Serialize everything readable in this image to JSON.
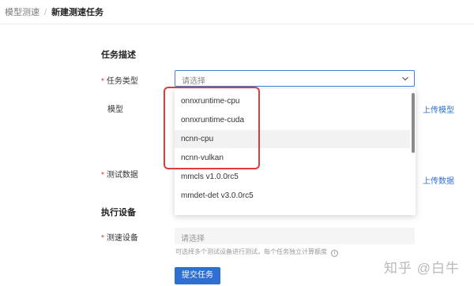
{
  "breadcrumb": {
    "parent": "模型测速",
    "separator": "/",
    "current": "新建测速任务"
  },
  "sections": {
    "task_desc": "任务描述",
    "exec_device": "执行设备"
  },
  "form": {
    "task_type": {
      "required_mark": "*",
      "label": "任务类型",
      "placeholder": "请选择"
    },
    "model": {
      "label": "模型",
      "upload_link": "上传模型"
    },
    "test_data": {
      "required_mark": "*",
      "label": "测试数据",
      "upload_link": "上传数据"
    },
    "device": {
      "required_mark": "*",
      "label": "测速设备",
      "placeholder": "请选择",
      "hint": "可选择多个测试设备进行测试，每个任务独立计算额度",
      "hint_icon": "i"
    },
    "submit_label": "提交任务"
  },
  "dropdown": {
    "options": [
      {
        "label": "onnxruntime-cpu"
      },
      {
        "label": "onnxruntime-cuda"
      },
      {
        "label": "ncnn-cpu",
        "active": true
      },
      {
        "label": "ncnn-vulkan"
      },
      {
        "label": "mmcls v1.0.0rc5"
      },
      {
        "label": "mmdet-det v3.0.0rc5"
      }
    ]
  },
  "watermark": "知乎 @白牛",
  "colors": {
    "primary": "#2f6fd1",
    "highlight_box": "#e03a3a",
    "required": "#d9363e"
  }
}
